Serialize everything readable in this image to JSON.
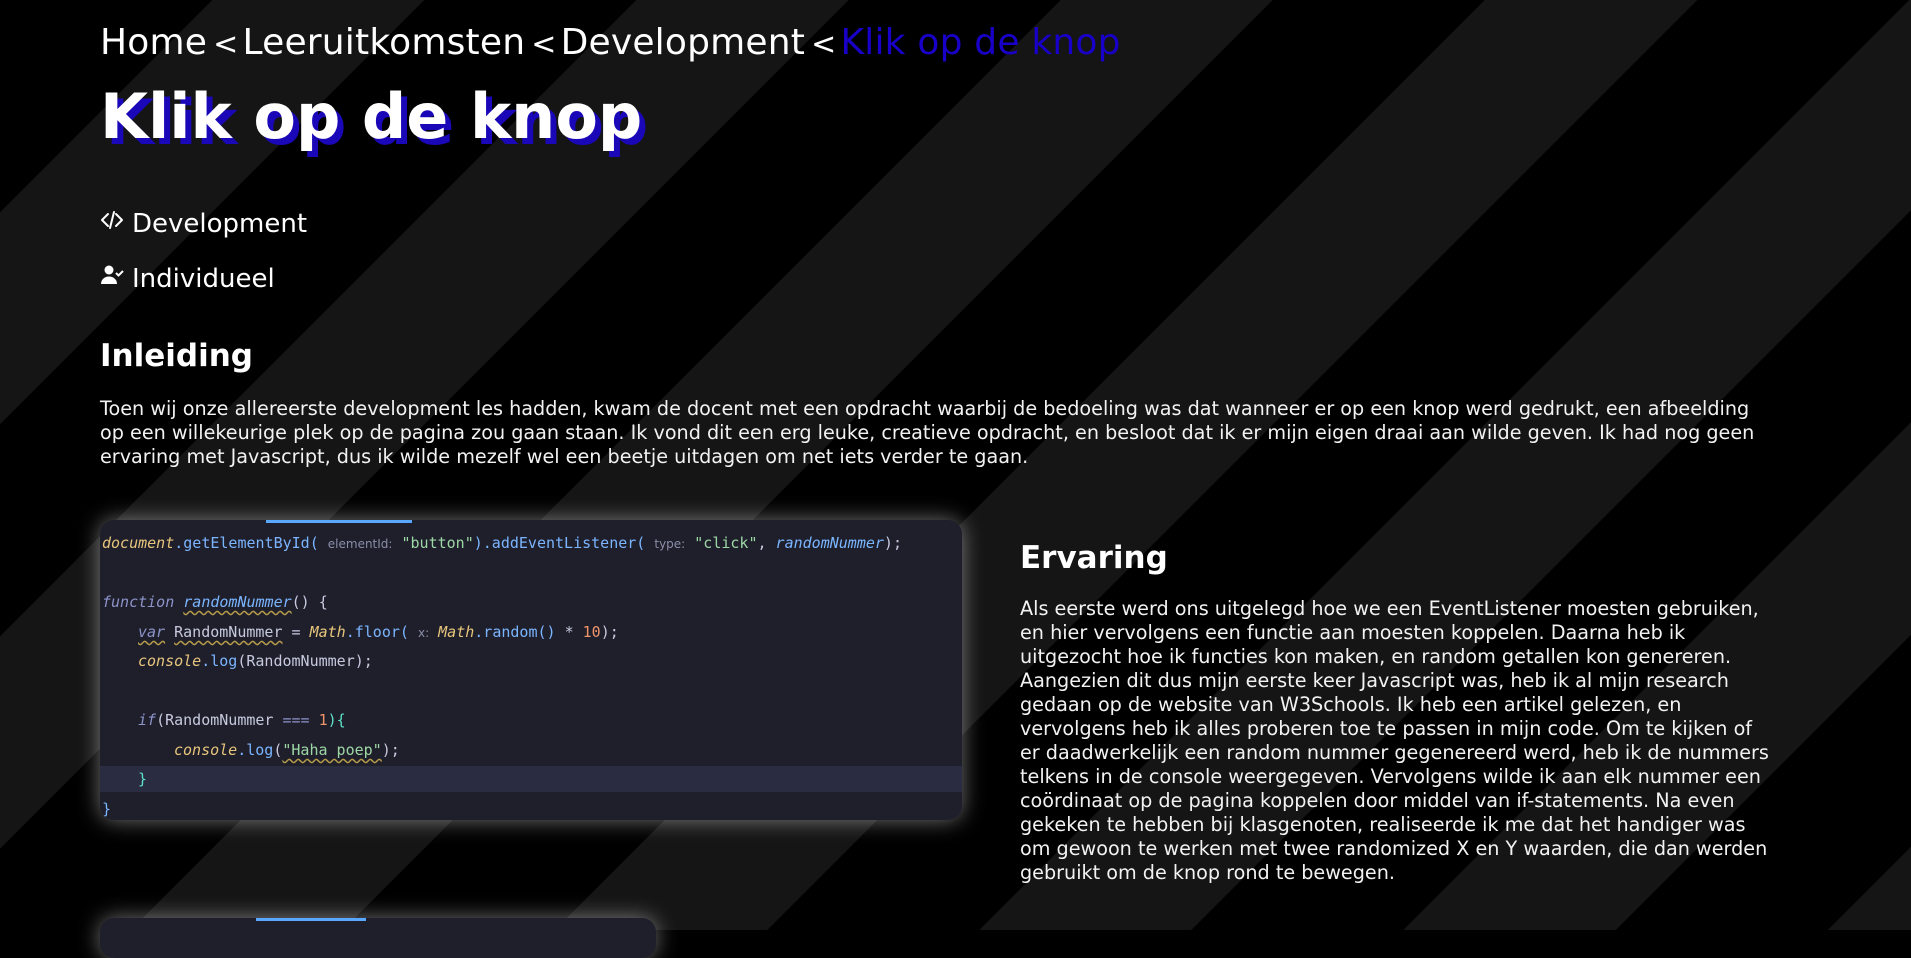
{
  "breadcrumb": {
    "items": [
      "Home",
      "Leeruitkomsten",
      "Development"
    ],
    "separator": "<",
    "current": "Klik op de knop"
  },
  "page_title": "Klik op de knop",
  "meta": {
    "category": "Development",
    "mode": "Individueel"
  },
  "inleiding": {
    "heading": "Inleiding",
    "text": "Toen wij onze allereerste development les hadden, kwam de docent met een opdracht waarbij de bedoeling was dat wanneer er op een knop werd gedrukt, een afbeelding op een willekeurige plek op de pagina zou gaan staan. Ik vond dit een erg leuke, creatieve opdracht, en besloot dat ik er mijn eigen draai aan wilde geven. Ik had nog geen ervaring met Javascript, dus ik wilde mezelf wel een beetje uitdagen om net iets verder te gaan."
  },
  "code": {
    "line1": {
      "obj": "document",
      "method": ".getElementById(",
      "hint1": "elementId:",
      "arg1": "\"button\"",
      "method2": ").addEventListener(",
      "hint2": "type:",
      "arg2": "\"click\"",
      "rest": ", ",
      "fnref": "randomNummer",
      "end": ");"
    },
    "line3": {
      "kw": "function",
      "name": "randomNummer",
      "rest": "() {"
    },
    "line4": {
      "kw": "var",
      "var": "RandomNummer",
      "eq": " = ",
      "math1": "Math",
      "floor": ".floor(",
      "hint": "x:",
      "math2": "Math",
      "random": ".random()",
      "op": " * ",
      "num": "10",
      "end": ");"
    },
    "line5": {
      "obj": "console",
      "log": ".log",
      "rest": "(RandomNummer);"
    },
    "line7": {
      "kw": "if",
      "rest": "(RandomNummer ",
      "op": "===",
      "num": " 1",
      "end": "){"
    },
    "line8": {
      "obj": "console",
      "log": ".log",
      "open": "(",
      "str": "\"Haha poep\"",
      "end": ");"
    },
    "line9": {
      "brace": "}"
    },
    "line10": {
      "brace": "}"
    }
  },
  "ervaring": {
    "heading": "Ervaring",
    "text": "Als eerste werd ons uitgelegd hoe we een EventListener moesten gebruiken, en hier vervolgens een functie aan moesten koppelen. Daarna heb ik uitgezocht hoe ik functies kon maken, en random getallen kon genereren. Aangezien dit dus mijn eerste keer Javascript was, heb ik al mijn research gedaan op de website van W3Schools. Ik heb een artikel gelezen, en vervolgens heb ik alles proberen toe te passen in mijn code. Om te kijken of er daadwerkelijk een random nummer gegenereerd werd, heb ik de nummers telkens in de console weergegeven. Vervolgens wilde ik aan elk nummer een coördinaat op de pagina koppelen door middel van if-statements. Na even gekeken te hebben bij klasgenoten, realiseerde ik me dat het handiger was om gewoon te werken met twee randomized X en Y waarden, die dan werden gebruikt om de knop rond te bewegen."
  },
  "icons": {
    "category_icon": "code-icon",
    "mode_icon": "user-check-icon"
  },
  "colors": {
    "accent": "#1800c8",
    "background": "#000000",
    "stripe": "#151515",
    "code_bg": "#1e1f2b"
  }
}
